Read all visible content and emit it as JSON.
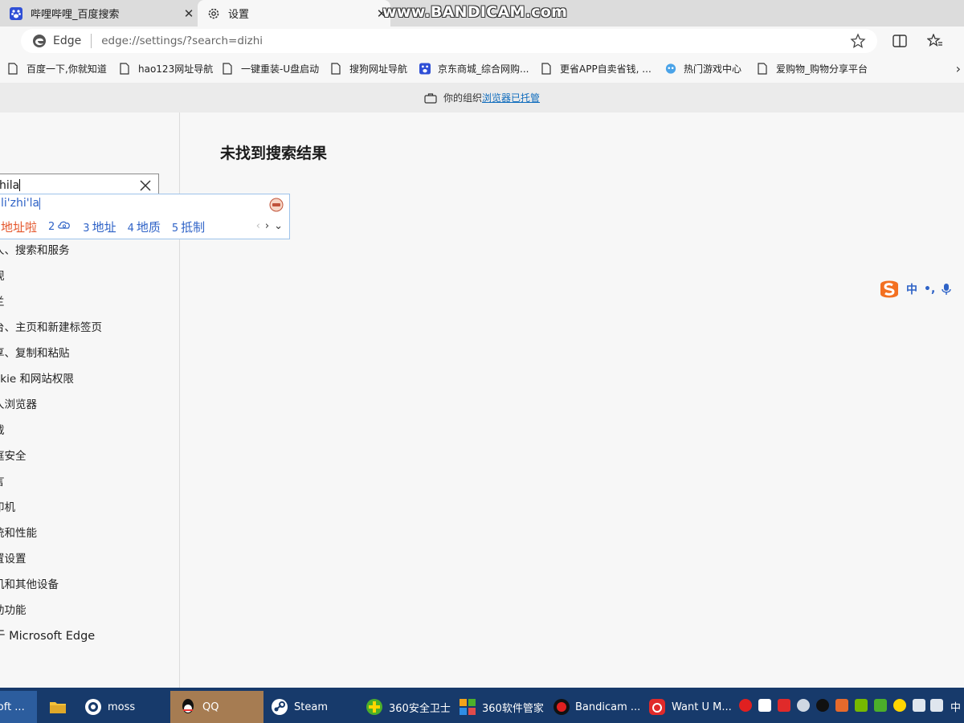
{
  "tabs": [
    {
      "title": "哔哩哔哩_百度搜索",
      "close": "✕"
    },
    {
      "title": "设置",
      "close": "✕"
    }
  ],
  "watermark": "www.BANDICAM.com",
  "address": {
    "brand": "Edge",
    "url": "edge://settings/?search=dizhi"
  },
  "favorites": [
    "百度一下,你就知道",
    "hao123网址导航",
    "一键重装-U盘启动",
    "搜狗网址导航",
    "京东商城_综合网购...",
    "更省APP自卖省钱, ...",
    "热门游戏中心",
    "爱购物_购物分享平台"
  ],
  "banner": {
    "prefix": "你的组织",
    "link": "浏览器已托管"
  },
  "search": {
    "value": "hila"
  },
  "main": {
    "no_results": "未找到搜索结果"
  },
  "ime": {
    "pinyin": "li'zhi'la",
    "candidates": [
      {
        "num": "",
        "text": "地址啦"
      },
      {
        "num": "2",
        "text": ""
      },
      {
        "num": "3",
        "text": "地址"
      },
      {
        "num": "4",
        "text": "地质"
      },
      {
        "num": "5",
        "text": "抵制"
      }
    ],
    "prev": "‹",
    "next": "›",
    "expand": "⌄"
  },
  "ime_status": {
    "lang": "中",
    "punct": "•,"
  },
  "menu": [
    "ὲ、搜索和服务",
    "ʼ𐐩",
    "ʼ",
    "ὲ、主页和新建标签页",
    "ʼ、复制和粘贴",
    "okie 和网站权限",
    "ὲ浏览器",
    "ʼ",
    "庭安全",
    "ʼ",
    "印机",
    "统和性能",
    "置设置",
    "机和其他设备",
    "助功能",
    "于 Microsoft Edge"
  ],
  "menu_display": [
    "人、搜索和服务",
    "观",
    "兰",
    "台、主页和新建标签页",
    "享、复制和粘贴",
    "okie 和网站权限",
    "人浏览器",
    "载",
    "庭安全",
    "言",
    "印机",
    "统和性能",
    "置设置",
    "机和其他设备",
    "助功能",
    "于 Microsoft Edge"
  ],
  "taskbar": [
    {
      "label": "soft ...",
      "icon": "edge-icon"
    },
    {
      "label": "",
      "icon": "file-explorer-icon"
    },
    {
      "label": "moss",
      "icon": "moss-icon"
    },
    {
      "label": "QQ",
      "icon": "qq-icon"
    },
    {
      "label": "Steam",
      "icon": "steam-icon"
    },
    {
      "label": "360安全卫士",
      "icon": "360-security-icon"
    },
    {
      "label": "360软件管家",
      "icon": "360-software-icon"
    },
    {
      "label": "Bandicam ...",
      "icon": "bandicam-icon"
    },
    {
      "label": "Want U M...",
      "icon": "netease-music-icon"
    }
  ],
  "tray_lang": "中",
  "colors": {
    "accent": "#0f6cbd",
    "taskbar": "#173a6b",
    "ime_blue": "#2f63c7",
    "ime_orange": "#e4562b"
  }
}
